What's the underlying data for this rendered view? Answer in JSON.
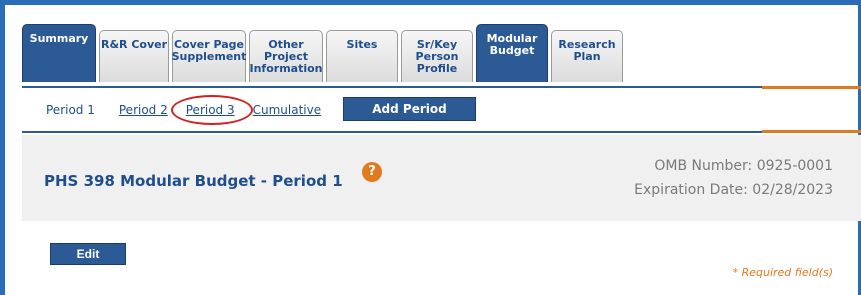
{
  "tabs": [
    {
      "label": "Summary",
      "active": true
    },
    {
      "label": "R&R Cover",
      "active": false
    },
    {
      "label": "Cover Page\nSupplement",
      "active": false
    },
    {
      "label": "Other\nProject\nInformation",
      "active": false
    },
    {
      "label": "Sites",
      "active": false
    },
    {
      "label": "Sr/Key\nPerson\nProfile",
      "active": false
    },
    {
      "label": "Modular\nBudget",
      "active": true
    },
    {
      "label": "Research\nPlan",
      "active": false
    }
  ],
  "subnav": {
    "current": "Period 1",
    "links": [
      "Period 2",
      "Period 3",
      "Cumulative"
    ],
    "add_period": "Add Period"
  },
  "header": {
    "title": "PHS 398 Modular Budget - Period 1",
    "help_icon": "?",
    "omb_number": "OMB Number: 0925-0001",
    "expiration": "Expiration Date: 02/28/2023"
  },
  "edit_label": "Edit",
  "required_note": "* Required field(s)",
  "colors": {
    "brand_blue": "#2b5a95",
    "accent_orange": "#e07a1f",
    "highlight_red": "#d42020"
  }
}
